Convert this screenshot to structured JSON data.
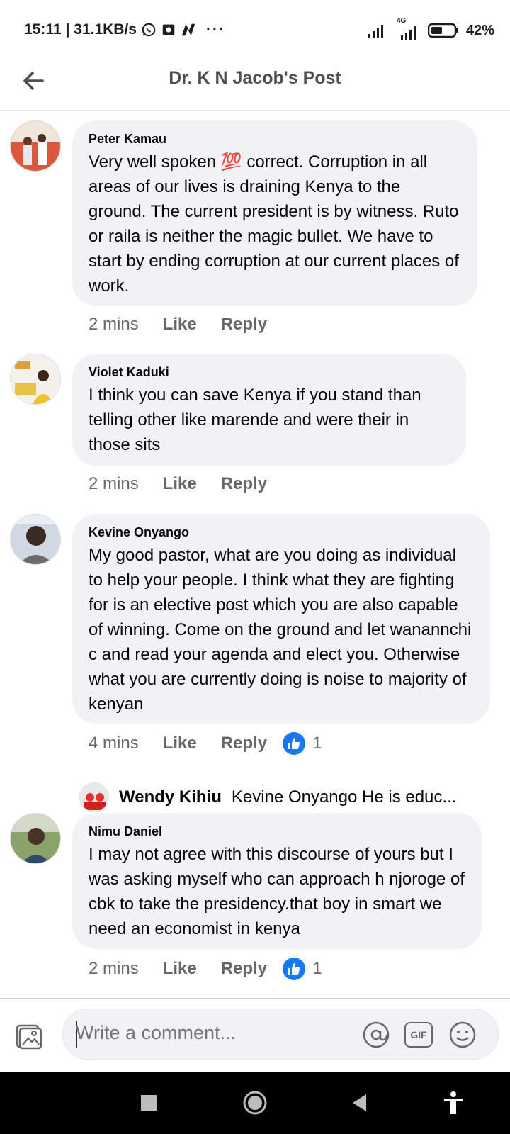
{
  "status": {
    "time": "15:11",
    "speed": "| 31.1KB/s",
    "more": "···",
    "network": "4G",
    "battery": "42%"
  },
  "header": {
    "title": "Dr. K N Jacob's Post"
  },
  "comments": [
    {
      "author": "Peter Kamau",
      "text": "Very well spoken 💯 correct. Corruption in all areas of our lives is draining Kenya to the ground. The current president is by witness. Ruto or raila is neither the magic bullet.  We have to start by ending corruption at our current places of work.",
      "time": "2 mins",
      "like": "Like",
      "reply": "Reply"
    },
    {
      "author": "Violet Kaduki",
      "text": "I think you can save Kenya if you stand than telling other like marende and were their in those sits",
      "time": "2 mins",
      "like": "Like",
      "reply": "Reply"
    },
    {
      "author": "Kevine Onyango",
      "text": "My good pastor, what are you doing as individual to help your people. I think what they are fighting for is an elective post which you are also capable of winning. Come on the ground and let wanannchi c and read your agenda and elect you. Otherwise what you are currently doing is noise to majority of kenyan",
      "time": "4 mins",
      "like": "Like",
      "reply": "Reply",
      "reactions": "1"
    },
    {
      "author": "Nimu Daniel",
      "text": "I may not agree with this discourse of yours but I was asking myself who can approach h njoroge of cbk to take the presidency.that boy in smart we need an economist in kenya",
      "time": "2 mins",
      "like": "Like",
      "reply": "Reply",
      "reactions": "1"
    }
  ],
  "reply_preview": {
    "name": "Wendy Kihiu",
    "text": "Kevine Onyango He is educ..."
  },
  "composer": {
    "placeholder": "Write a comment...",
    "gif": "GIF"
  },
  "colors": {
    "bubble": "#f0f2f5",
    "meta": "#65676b",
    "like_blue": "#1877f2"
  }
}
